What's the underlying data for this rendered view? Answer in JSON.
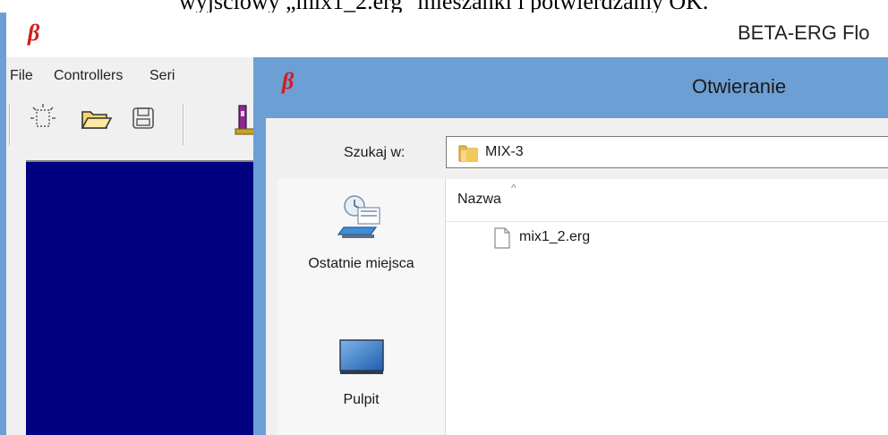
{
  "caption_fragment": "wyjściowy „mix1_2.erg\" mieszanki i potwierdzamy OK.",
  "app": {
    "logo_glyph": "β",
    "title": "BETA-ERG Flo"
  },
  "menu": {
    "items": [
      "File",
      "Controllers",
      "Seri"
    ]
  },
  "toolbar": {
    "icons": [
      "new-file-icon",
      "open-folder-icon",
      "save-icon",
      "flow-meter-icon"
    ]
  },
  "dialog": {
    "logo_glyph": "β",
    "title": "Otwieranie",
    "look_in_label": "Szukaj w:",
    "look_in_value": "MIX-3",
    "places": [
      {
        "label": "Ostatnie miejsca",
        "icon": "recent-places-icon"
      },
      {
        "label": "Pulpit",
        "icon": "desktop-icon"
      }
    ],
    "column_name": "Nazwa",
    "sort_indicator": "^",
    "files": [
      {
        "name": "mix1_2.erg",
        "icon": "document-icon"
      }
    ]
  },
  "colors": {
    "dialog_frame": "#6c9fd4",
    "canvas_bg": "#000080",
    "logo_red": "#d21e1e"
  }
}
